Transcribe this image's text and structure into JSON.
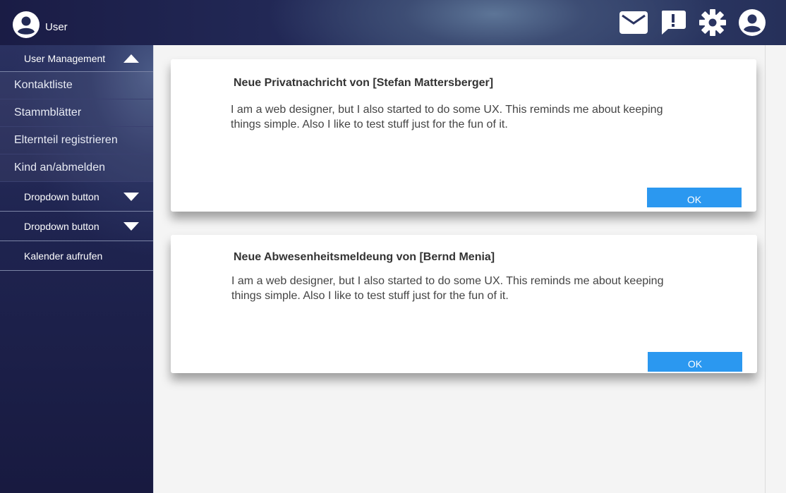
{
  "header": {
    "user_label": "User",
    "icons": [
      "mail-icon",
      "alert-icon",
      "settings-icon",
      "account-icon"
    ]
  },
  "sidebar": {
    "group_user_management": "User Management",
    "items": [
      {
        "label": "Kontaktliste"
      },
      {
        "label": "Stammblätter"
      },
      {
        "label": "Elternteil registrieren"
      },
      {
        "label": "Kind an/abmelden"
      }
    ],
    "dropdown_1": "Dropdown button",
    "dropdown_2": "Dropdown button",
    "calendar": "Kalender aufrufen"
  },
  "cards": [
    {
      "title": "Neue Privatnachricht von [Stefan Mattersberger]",
      "body": "I am a web designer, but I also started to do some UX. This reminds me about keeping things simple. Also I like to test stuff just for the fun of it.",
      "ok_label": "OK"
    },
    {
      "title": "Neue Abwesenheitsmeldeung von [Bernd Menia]",
      "body": "I am a web designer, but I also started to do some UX. This reminds me about keeping things simple. Also I like to test stuff just for the fun of it.",
      "ok_label": "OK"
    }
  ],
  "colors": {
    "accent": "#2b98f0",
    "topbar": "#232a58",
    "sidebar": "#1f2450"
  }
}
